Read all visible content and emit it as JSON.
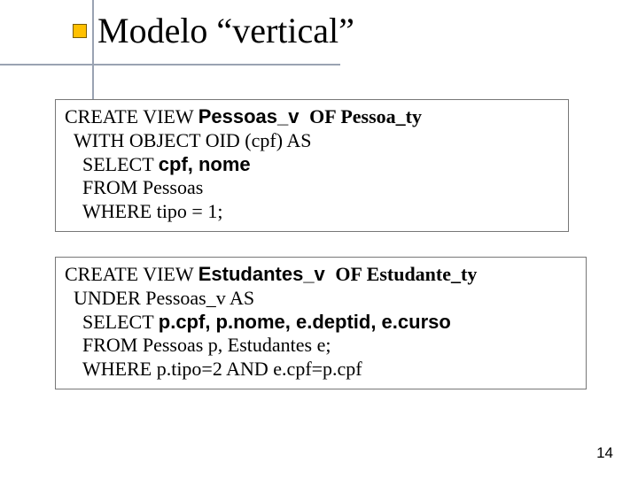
{
  "title": "Modelo “vertical”",
  "page_number": "14",
  "box1": {
    "l1_a": "CREATE VIEW ",
    "l1_b": "Pessoas_v ",
    "l1_c": " OF Pessoa_ty",
    "l2": "WITH OBJECT OID (cpf) AS",
    "l3_a": "SELECT ",
    "l3_b": "cpf, nome",
    "l4": "FROM Pessoas",
    "l5": "WHERE tipo = 1;"
  },
  "box2": {
    "l1_a": "CREATE VIEW ",
    "l1_b": "Estudantes_v ",
    "l1_c": " OF Estudante_ty",
    "l2": "UNDER Pessoas_v AS",
    "l3_a": "SELECT ",
    "l3_b": "p.cpf, p.nome, e.deptid, e.curso",
    "l4": "FROM Pessoas p, Estudantes e;",
    "l5": "WHERE p.tipo=2 AND e.cpf=p.cpf"
  }
}
